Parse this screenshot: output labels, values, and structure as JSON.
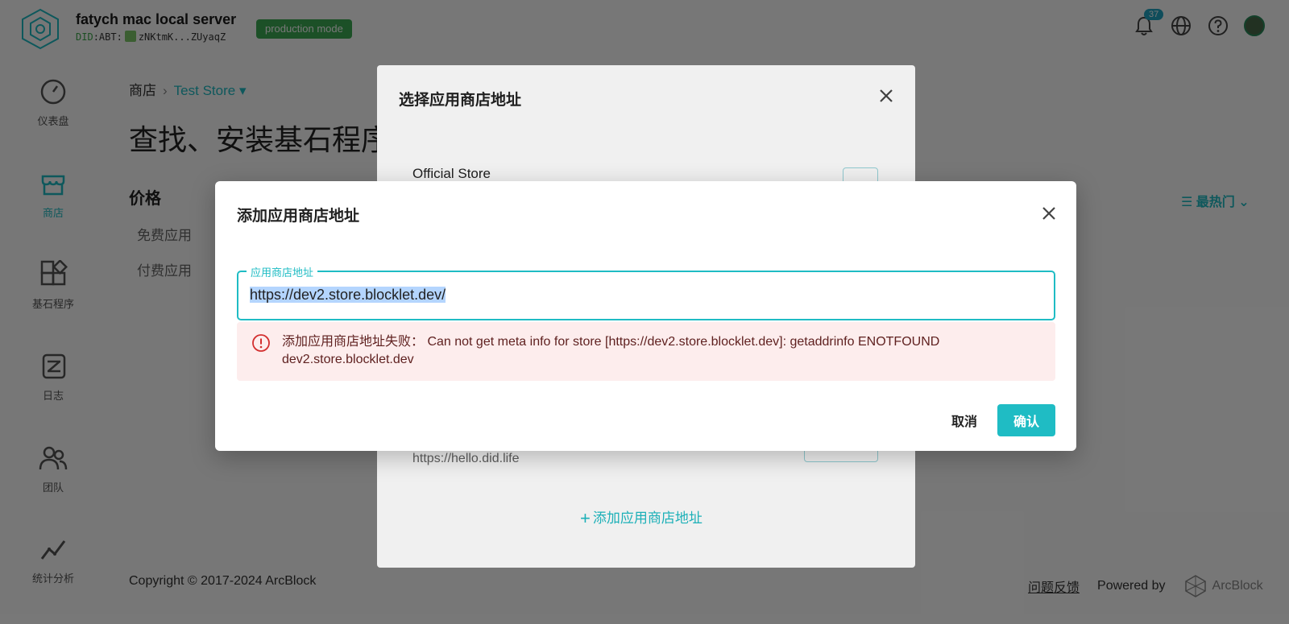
{
  "header": {
    "server_name": "fatych mac local server",
    "did_prefix": "DID",
    "did_value": ":ABT:",
    "did_short": "zNKtmK...ZUyaqZ",
    "mode_badge": "production mode",
    "notification_count": "37",
    "icons": [
      "bell-icon",
      "globe-icon",
      "help-icon",
      "user-avatar"
    ]
  },
  "sidebar": {
    "items": [
      {
        "label": "仪表盘",
        "icon": "dashboard-icon"
      },
      {
        "label": "商店",
        "icon": "store-icon"
      },
      {
        "label": "基石程序",
        "icon": "blocklet-icon"
      },
      {
        "label": "日志",
        "icon": "log-icon"
      },
      {
        "label": "团队",
        "icon": "team-icon"
      },
      {
        "label": "统计分析",
        "icon": "analytics-icon"
      }
    ],
    "active_index": 1
  },
  "main": {
    "breadcrumb_root": "商店",
    "breadcrumb_sep": "›",
    "breadcrumb_store": "Test Store",
    "page_title": "查找、安装基石程序",
    "filter_title": "价格",
    "filters": [
      "免费应用",
      "付费应用"
    ],
    "sort_label": "最热门"
  },
  "footer": {
    "copyright": "Copyright © 2017-2024  ArcBlock",
    "feedback": "问题反馈",
    "powered_by": "Powered by",
    "brand": "ArcBlock"
  },
  "store_dialog": {
    "title": "选择应用商店地址",
    "store_name": "Official Store",
    "store_url": "https://hello.did.life",
    "add_link": "添加应用商店地址"
  },
  "add_dialog": {
    "title": "添加应用商店地址",
    "field_label": "应用商店地址",
    "field_value": "https://dev2.store.blocklet.dev/",
    "error_message": "添加应用商店地址失败：  Can not get meta info for store [https://dev2.store.blocklet.dev]: getaddrinfo ENOTFOUND dev2.store.blocklet.dev",
    "cancel_label": "取消",
    "confirm_label": "确认"
  },
  "colors": {
    "accent": "#1fbcc4",
    "badge_green": "#3cab54",
    "error_bg": "#fdeded",
    "error_text": "#5f2120",
    "error_icon": "#d32f2f"
  }
}
